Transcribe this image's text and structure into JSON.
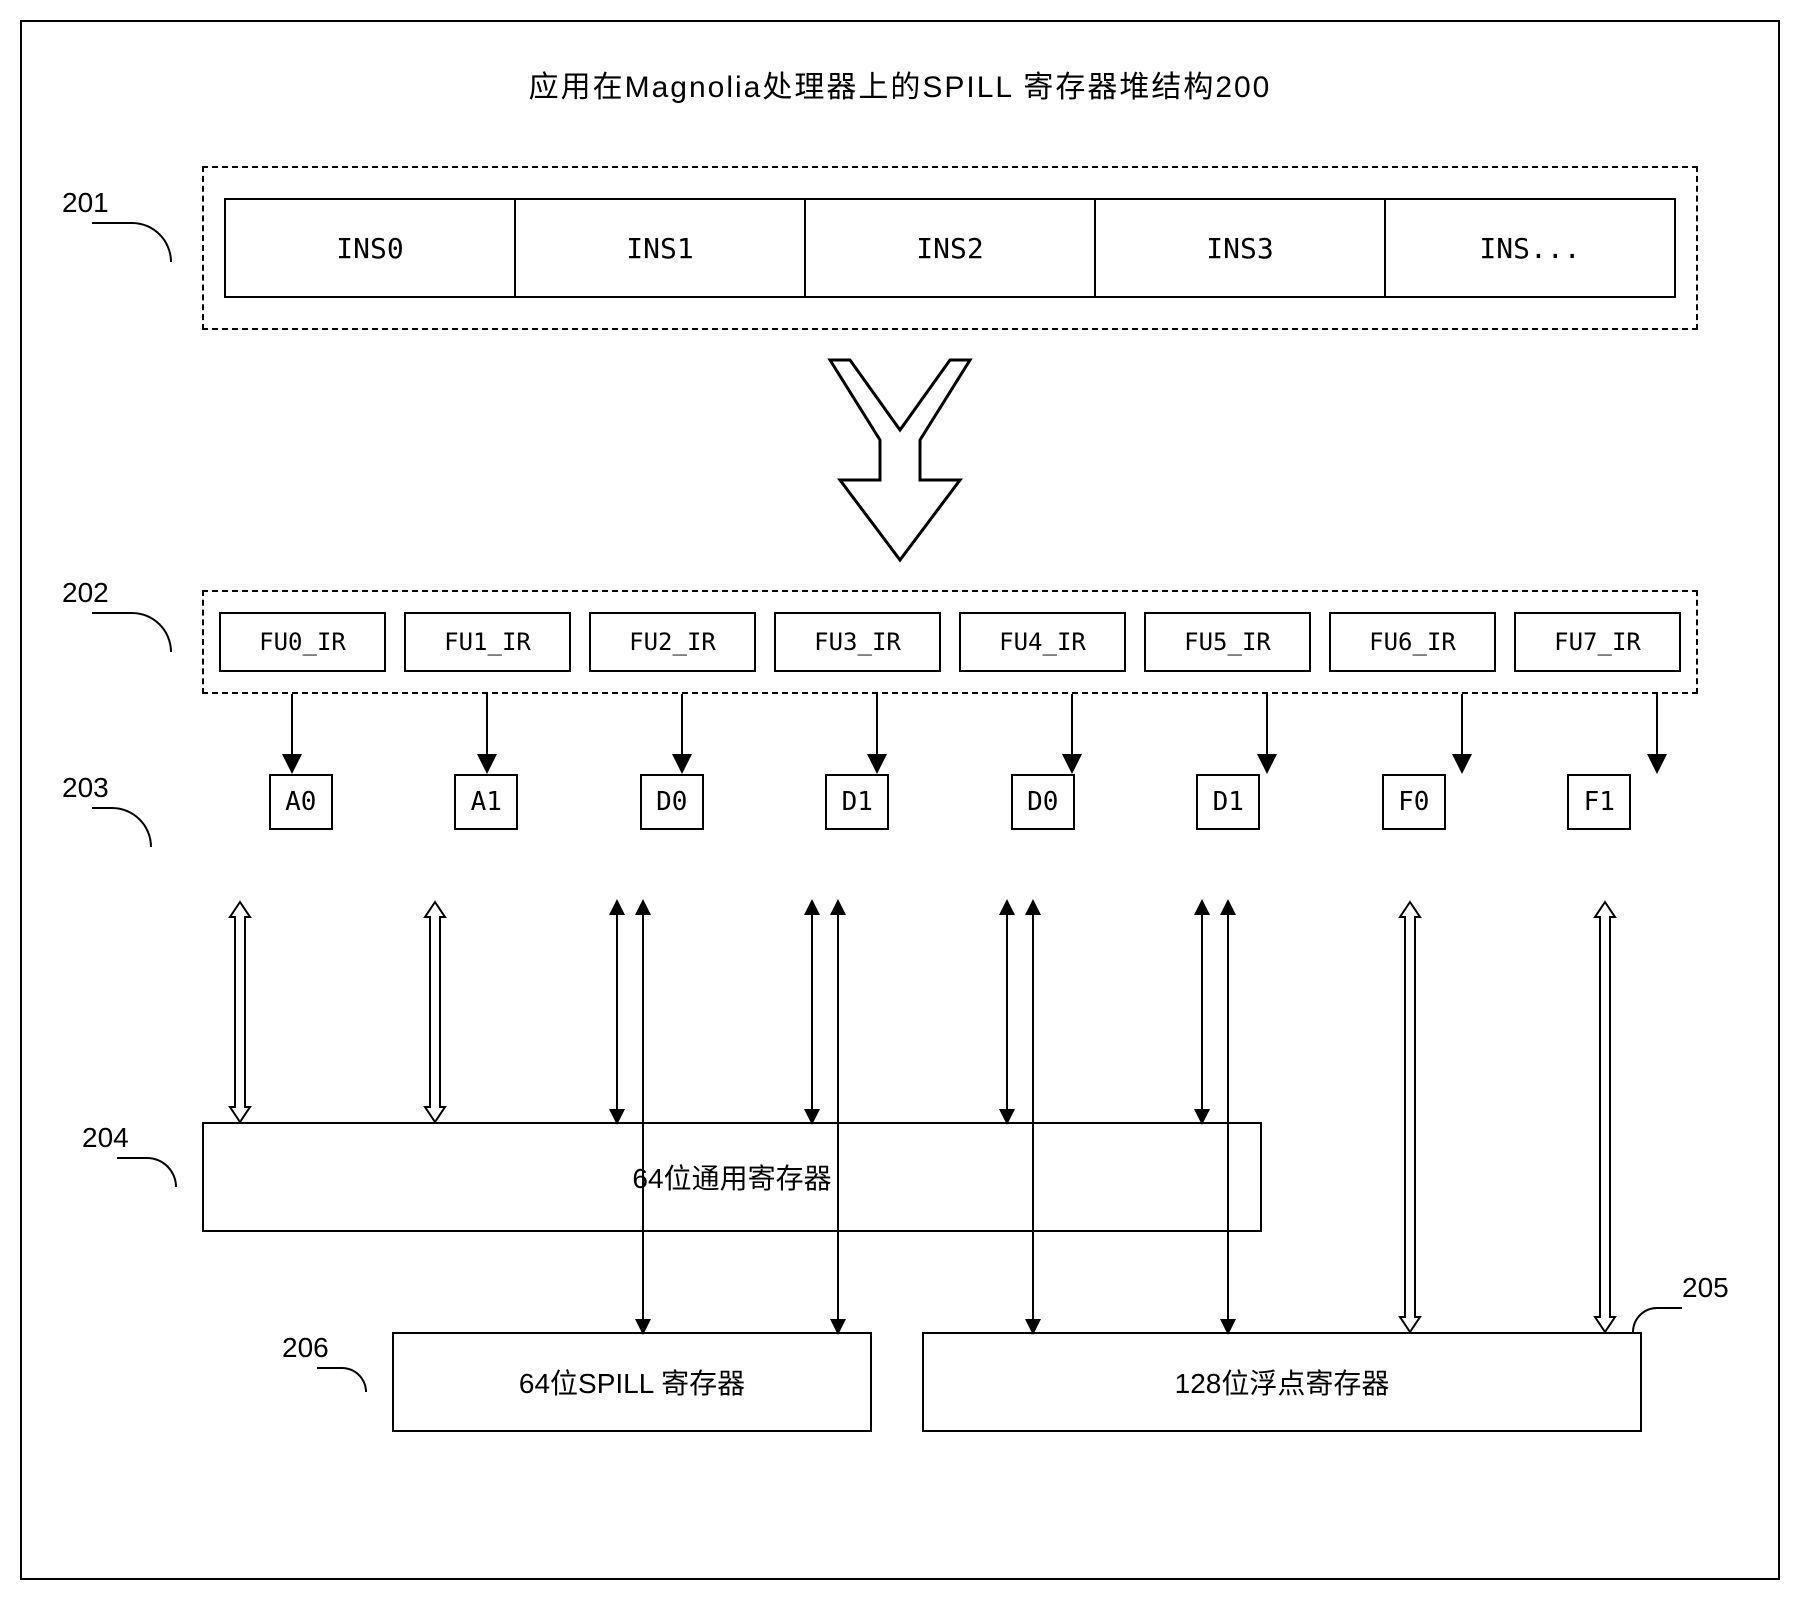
{
  "title": "应用在Magnolia处理器上的SPILL 寄存器堆结构200",
  "refs": {
    "r201": "201",
    "r202": "202",
    "r203": "203",
    "r204": "204",
    "r205": "205",
    "r206": "206"
  },
  "ins": [
    "INS0",
    "INS1",
    "INS2",
    "INS3",
    "INS..."
  ],
  "ir": [
    "FU0_IR",
    "FU1_IR",
    "FU2_IR",
    "FU3_IR",
    "FU4_IR",
    "FU5_IR",
    "FU6_IR",
    "FU7_IR"
  ],
  "fu": [
    "A0",
    "A1",
    "D0",
    "D1",
    "D0",
    "D1",
    "F0",
    "F1"
  ],
  "reg64": "64位通用寄存器",
  "spill64": "64位SPILL 寄存器",
  "fp128": "128位浮点寄存器"
}
